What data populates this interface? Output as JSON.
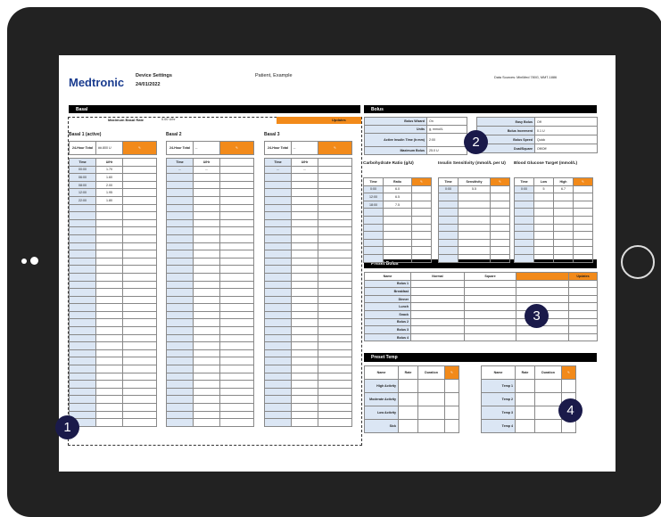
{
  "header": {
    "logo": "Medtronic",
    "title": "Device Settings",
    "date": "24/01/2022",
    "patient": "Patient, Example",
    "sources": "Data Sources: MiniMed 780G, MMT-1886"
  },
  "basal": {
    "section": "Basal",
    "max_label": "Maximum Basal Rate",
    "max_value": "0.00 U/hr",
    "updates": "Updates",
    "patterns": [
      {
        "title": "Basal 1 (active)",
        "total_label": "24-Hour Total",
        "total": "##.800 U",
        "rows": [
          [
            "00:00",
            "1.70"
          ],
          [
            "06:00",
            "1.60"
          ],
          [
            "08:00",
            "2.00"
          ],
          [
            "12:00",
            "1.95"
          ],
          [
            "22:00",
            "1.80"
          ]
        ]
      },
      {
        "title": "Basal 2",
        "total_label": "24-Hour Total",
        "total": "--",
        "rows": [
          [
            "--",
            "--"
          ]
        ]
      },
      {
        "title": "Basal 3",
        "total_label": "24-Hour Total",
        "total": "--",
        "rows": [
          [
            "--",
            "--"
          ]
        ]
      }
    ],
    "col_time": "Time",
    "col_rate": "U/Hr"
  },
  "bolus": {
    "section": "Bolus",
    "left": [
      [
        "Bolus Wizard",
        "On"
      ],
      [
        "Units",
        "g, mmol/L"
      ],
      [
        "Active Insulin Time (h:mm)",
        "2:00"
      ],
      [
        "Maximum Bolus",
        "25.0 U"
      ]
    ],
    "right": [
      [
        "Easy Bolus",
        "Off"
      ],
      [
        "Bolus Increment",
        "0.1 U"
      ],
      [
        "Bolus Speed",
        "Quick"
      ],
      [
        "Dual/Square",
        "Off/Off"
      ]
    ],
    "carb": {
      "title": "Carbohydrate Ratio (g/U)",
      "cols": [
        "Time",
        "Ratio"
      ],
      "rows": [
        [
          "0:00",
          "6.0"
        ],
        [
          "12:00",
          "6.5"
        ],
        [
          "18:00",
          "7.5"
        ]
      ]
    },
    "isf": {
      "title": "Insulin Sensitivity (mmol/L per U)",
      "cols": [
        "Time",
        "Sensitivity"
      ],
      "rows": [
        [
          "0:00",
          "5.5"
        ]
      ]
    },
    "bg": {
      "title": "Blood Glucose Target (mmol/L)",
      "cols": [
        "Time",
        "Low",
        "High"
      ],
      "rows": [
        [
          "0:00",
          "5",
          "6.7"
        ]
      ]
    }
  },
  "preset_bolus": {
    "section": "Preset Bolus",
    "cols": [
      "Name",
      "Normal",
      "Square",
      "Updates"
    ],
    "rows": [
      "Bolus 1",
      "Breakfast",
      "Dinner",
      "Lunch",
      "Snack",
      "Bolus 2",
      "Bolus 3",
      "Bolus 4"
    ]
  },
  "preset_temp": {
    "section": "Preset Temp",
    "cols": [
      "Name",
      "Rate",
      "Duration"
    ],
    "left_rows": [
      "High Activity",
      "Moderate Activity",
      "Low Activity",
      "Sick"
    ],
    "right_rows": [
      "Temp 1",
      "Temp 2",
      "Temp 3",
      "Temp 4"
    ]
  },
  "callouts": [
    "1",
    "2",
    "3",
    "4"
  ]
}
